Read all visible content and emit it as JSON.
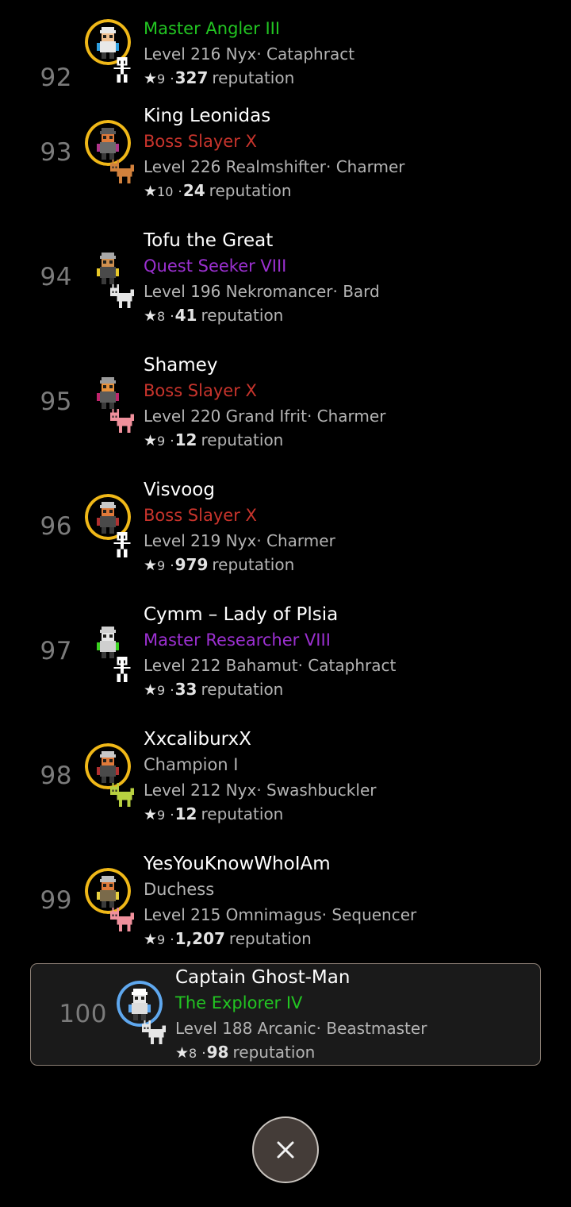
{
  "screen": {
    "background": "#000000",
    "kind": "leaderboard-list"
  },
  "colors": {
    "title_green": "#22c522",
    "title_red": "#c8342c",
    "title_purple": "#9b30d0",
    "title_gray": "#b4b4b4",
    "rank": "#7b7b7b",
    "meta": "#b4b4b4",
    "name": "#ffffff",
    "highlight_border": "#8d8076",
    "highlight_bg": "#1a1a1a",
    "close_fill": "#443c38",
    "close_border": "#c9c4bf"
  },
  "leaderboard": {
    "entries": [
      {
        "rank": "92",
        "name": "",
        "title": "Master Angler III",
        "title_color": "#22c522",
        "level_label": "Level",
        "level": "216",
        "race": "Nyx",
        "separator": "·",
        "class": "Cataphract",
        "meta": "Level 216 Nyx· Cataphract",
        "star_glyph": "★",
        "star_count": "9",
        "rep_separator": "·",
        "reputation": "327",
        "rep_label": "reputation",
        "avatar": {
          "name": "angler-avatar",
          "ring": "gold",
          "skin": "#f0c090",
          "hair": "#e8e8e8",
          "body": "#e8e8e8",
          "accent": "#2f9fe0"
        },
        "pet": {
          "name": "skeleton-pet",
          "color": "#ffffff"
        },
        "highlighted": false,
        "clipped": true
      },
      {
        "rank": "93",
        "name": "King Leonidas",
        "title": "Boss Slayer X",
        "title_color": "#c8342c",
        "level_label": "Level",
        "level": "226",
        "race": "Realmshifter",
        "separator": "·",
        "class": "Charmer",
        "meta": "Level 226 Realmshifter· Charmer",
        "star_glyph": "★",
        "star_count": "10",
        "rep_separator": "·",
        "reputation": "24",
        "rep_label": "reputation",
        "avatar": {
          "name": "knight-avatar",
          "ring": "gold",
          "skin": "#e07a3a",
          "hair": "#5a5a5a",
          "body": "#6b6b6b",
          "accent": "#b0368c"
        },
        "pet": {
          "name": "dog-pet",
          "color": "#d2813c"
        },
        "highlighted": false,
        "clipped": false
      },
      {
        "rank": "94",
        "name": "Tofu the Great",
        "title": "Quest Seeker VIII",
        "title_color": "#9b30d0",
        "level_label": "Level",
        "level": "196",
        "race": "Nekromancer",
        "separator": "·",
        "class": "Bard",
        "meta": "Level 196 Nekromancer· Bard",
        "star_glyph": "★",
        "star_count": "8",
        "rep_separator": "·",
        "reputation": "41",
        "rep_label": "reputation",
        "avatar": {
          "name": "nekromancer-avatar",
          "ring": "none",
          "skin": "#d09050",
          "hair": "#a8a8a8",
          "body": "#4a4a4a",
          "accent": "#e8c828"
        },
        "pet": {
          "name": "white-beast-pet",
          "color": "#e6e6e6"
        },
        "highlighted": false,
        "clipped": false
      },
      {
        "rank": "95",
        "name": "Shamey",
        "title": "Boss Slayer X",
        "title_color": "#c8342c",
        "level_label": "Level",
        "level": "220",
        "race": "Grand Ifrit",
        "separator": "·",
        "class": "Charmer",
        "meta": "Level 220 Grand Ifrit· Charmer",
        "star_glyph": "★",
        "star_count": "9",
        "rep_separator": "·",
        "reputation": "12",
        "rep_label": "reputation",
        "avatar": {
          "name": "ifrit-avatar",
          "ring": "none",
          "skin": "#e8923c",
          "hair": "#9a9a9a",
          "body": "#5a5a5a",
          "accent": "#c0246c"
        },
        "pet": {
          "name": "pink-beast-pet",
          "color": "#f0909c"
        },
        "highlighted": false,
        "clipped": false
      },
      {
        "rank": "96",
        "name": "Visvoog",
        "title": "Boss Slayer X",
        "title_color": "#c8342c",
        "level_label": "Level",
        "level": "219",
        "race": "Nyx",
        "separator": "·",
        "class": "Charmer",
        "meta": "Level 219 Nyx· Charmer",
        "star_glyph": "★",
        "star_count": "9",
        "rep_separator": "·",
        "reputation": "979",
        "rep_label": "reputation",
        "avatar": {
          "name": "warrior-avatar",
          "ring": "gold",
          "skin": "#e07a3a",
          "hair": "#c8c8c8",
          "body": "#4a4a4a",
          "accent": "#b03030"
        },
        "pet": {
          "name": "skeleton-pet",
          "color": "#ffffff"
        },
        "highlighted": false,
        "clipped": false
      },
      {
        "rank": "97",
        "name": "Cymm – Lady of Plsia",
        "title": "Master Researcher VIII",
        "title_color": "#9b30d0",
        "level_label": "Level",
        "level": "212",
        "race": "Bahamut",
        "separator": "·",
        "class": "Cataphract",
        "meta": "Level 212 Bahamut· Cataphract",
        "star_glyph": "★",
        "star_count": "9",
        "rep_separator": "·",
        "reputation": "33",
        "rep_label": "reputation",
        "avatar": {
          "name": "researcher-avatar",
          "ring": "none",
          "skin": "#e8e8e8",
          "hair": "#d0d0d0",
          "body": "#cfcfcf",
          "accent": "#3ad020"
        },
        "pet": {
          "name": "skeleton-pet",
          "color": "#ffffff"
        },
        "highlighted": false,
        "clipped": false
      },
      {
        "rank": "98",
        "name": "XxcaliburxX",
        "title": "Champion I",
        "title_color": "#b4b4b4",
        "level_label": "Level",
        "level": "212",
        "race": "Nyx",
        "separator": "·",
        "class": "Swashbuckler",
        "meta": "Level 212 Nyx· Swashbuckler",
        "star_glyph": "★",
        "star_count": "9",
        "rep_separator": "·",
        "reputation": "12",
        "rep_label": "reputation",
        "avatar": {
          "name": "swashbuckler-avatar",
          "ring": "gold",
          "skin": "#e07a3a",
          "hair": "#c8c8c8",
          "body": "#4a4a4a",
          "accent": "#b03030"
        },
        "pet": {
          "name": "goblin-pet",
          "color": "#b8d040"
        },
        "highlighted": false,
        "clipped": false
      },
      {
        "rank": "99",
        "name": "YesYouKnowWhoIAm",
        "title": "Duchess",
        "title_color": "#b4b4b4",
        "level_label": "Level",
        "level": "215",
        "race": "Omnimagus",
        "separator": "·",
        "class": "Sequencer",
        "meta": "Level 215 Omnimagus· Sequencer",
        "star_glyph": "★",
        "star_count": "9",
        "rep_separator": "·",
        "reputation": "1,207",
        "rep_label": "reputation",
        "avatar": {
          "name": "omnimagus-avatar",
          "ring": "gold",
          "skin": "#e07a3a",
          "hair": "#c0c0c0",
          "body": "#7a6a4a",
          "accent": "#e8d040"
        },
        "pet": {
          "name": "pink-beast-pet",
          "color": "#f0909c"
        },
        "highlighted": false,
        "clipped": false
      },
      {
        "rank": "100",
        "name": "Captain Ghost-Man",
        "title": "The Explorer IV",
        "title_color": "#22c522",
        "level_label": "Level",
        "level": "188",
        "race": "Arcanic",
        "separator": "·",
        "class": "Beastmaster",
        "meta": "Level 188 Arcanic· Beastmaster",
        "star_glyph": "★",
        "star_count": "8",
        "rep_separator": "·",
        "reputation": "98",
        "rep_label": "reputation",
        "avatar": {
          "name": "ghost-avatar",
          "ring": "blue",
          "skin": "#e8e8e8",
          "hair": "#ffffff",
          "body": "#dcdcdc",
          "accent": "#5fa8ef"
        },
        "pet": {
          "name": "white-beast-pet",
          "color": "#e6e6e6"
        },
        "highlighted": true,
        "clipped": false
      }
    ]
  },
  "footer": {
    "close_button": {
      "icon": "close-icon",
      "label": "✕"
    }
  }
}
